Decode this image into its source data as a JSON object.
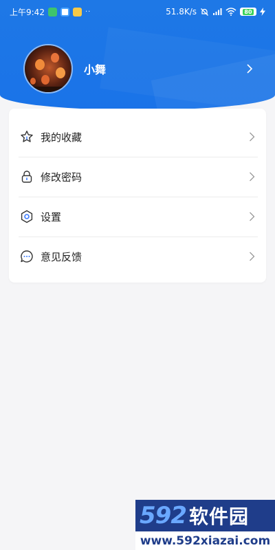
{
  "status_bar": {
    "time": "上午9:42",
    "dots": "··",
    "network_speed": "51.8K/s",
    "battery": "80"
  },
  "profile": {
    "username": "小舞"
  },
  "menu": {
    "items": [
      {
        "label": "我的收藏",
        "icon": "star-icon"
      },
      {
        "label": "修改密码",
        "icon": "lock-icon"
      },
      {
        "label": "设置",
        "icon": "settings-hex-icon"
      },
      {
        "label": "意见反馈",
        "icon": "chat-bubble-icon"
      }
    ]
  },
  "watermark": {
    "number": "592",
    "brand": "软件园",
    "url": "www.592xiazai.com"
  },
  "colors": {
    "header_blue": "#1a73e8",
    "page_bg": "#f5f5f7",
    "watermark_navy": "#1f3d8a",
    "watermark_accent": "#6aa8ff"
  }
}
